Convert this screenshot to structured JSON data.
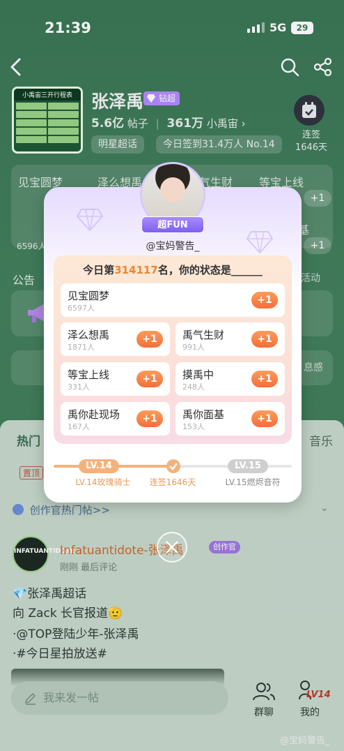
{
  "status": {
    "time": "21:39",
    "network": "5G",
    "battery": "29"
  },
  "forum": {
    "name": "张泽禹",
    "badge": "钻超",
    "cover_title": "小禹宙三开行程表",
    "posts_value": "5.6亿",
    "posts_label": "帖子",
    "members_value": "361万",
    "members_label": "小禹宙",
    "tags": [
      "明星超话",
      "今日签到31.4万人 No.14"
    ],
    "checkin_label": "连签",
    "checkin_days": "1646天"
  },
  "background_cards": {
    "titles": [
      "见宝圆梦",
      "泽么想禹",
      "禹气生财",
      "等宝上线"
    ],
    "count": "6596人",
    "partial_item": "基",
    "plus": "+1"
  },
  "notice": {
    "title": "公告",
    "right": "活动",
    "right2": "息感"
  },
  "feed": {
    "tab_hot": "热门",
    "tab_music": "音乐",
    "pin": "置顶",
    "hot_posts": "创作官热门帖>>",
    "author_avatar_text": "INFATUANTIDOTE",
    "author": "Infatuantidote-张泽禹",
    "creator_badge": "创作官",
    "meta": "刚刚  最后评论",
    "lines": [
      "张泽禹超话",
      "向 Zack 长官报道🫡",
      "·@TOP登陆少年-张泽禹",
      "·#今日星拍放送#"
    ]
  },
  "bottom": {
    "compose_placeholder": "我来发一帖",
    "group_chat": "群聊",
    "mine": "我的",
    "mine_level": "LV14",
    "watermark": "@宝妈警告_"
  },
  "modal": {
    "badge": "超FUN",
    "username": "@宝妈警告_",
    "head_prefix": "今日第",
    "rank": "314117",
    "head_suffix": "名，你的状态是______",
    "plus_label": "+1",
    "options": [
      {
        "name": "见宝圆梦",
        "count": "6597人"
      },
      {
        "name": "泽么想禹",
        "count": "1871人"
      },
      {
        "name": "禹气生财",
        "count": "991人"
      },
      {
        "name": "等宝上线",
        "count": "331人"
      },
      {
        "name": "摸禹中",
        "count": "248人"
      },
      {
        "name": "禹你赴现场",
        "count": "167人"
      },
      {
        "name": "禹你面基",
        "count": "153人"
      }
    ],
    "level": {
      "current": "LV.14",
      "next": "LV.15",
      "current_title": "LV.14玫瑰骑士",
      "streak": "连签1646天",
      "next_title": "LV.15燃烬音符",
      "progress": 0.5
    }
  },
  "colors": {
    "accent_orange": "#f36f3a",
    "purple": "#8f6cf2",
    "bg_green": "#3f7a5a"
  }
}
